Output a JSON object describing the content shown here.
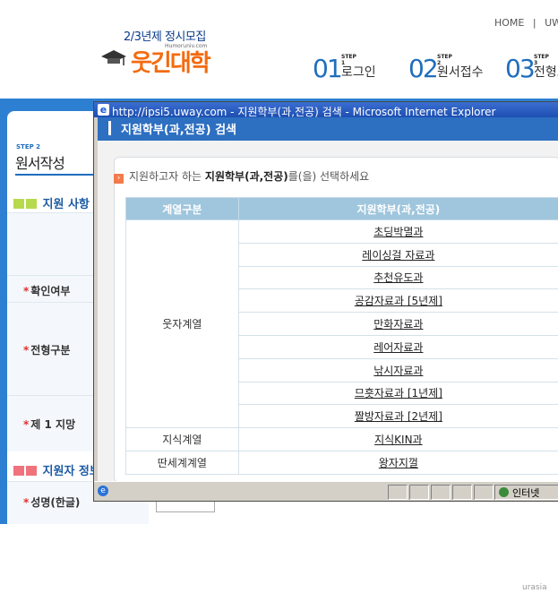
{
  "header": {
    "logo_sub": "2/3년제 정시모집",
    "logo_main": "웃긴대학",
    "logo_url": "Humoruniv.com",
    "top_links": [
      "HOME",
      "|",
      "UWA"
    ],
    "steps": [
      {
        "num": "01",
        "tag": "STEP 1",
        "label": "로그인"
      },
      {
        "num": "02",
        "tag": "STEP 2",
        "label": "원서접수"
      },
      {
        "num": "03",
        "tag": "STEP 3",
        "label": "전형료"
      }
    ]
  },
  "page": {
    "step_tag": "STEP 2",
    "title": "원서작성",
    "section1": "지원 사항",
    "section2": "지원자 정보",
    "rows": [
      {
        "label": "확인여부"
      },
      {
        "label": "전형구분"
      },
      {
        "label": "제 1 지망"
      },
      {
        "label": "성명(한글)"
      }
    ],
    "watermark": "urasia"
  },
  "popup": {
    "window_title": "http://ipsi5.uway.com - 지원학부(과,전공) 검색 - Microsoft Internet Explorer",
    "header": "지원학부(과,전공) 검색",
    "instruction_pre": "지원하고자 하는 ",
    "instruction_bold": "지원학부(과,전공)",
    "instruction_post": "를(을) 선택하세요",
    "table": {
      "headers": [
        "계열구분",
        "지원학부(과,전공)"
      ],
      "groups": [
        {
          "category": "웃자계열",
          "majors": [
            "초딩박멸과",
            "레이싱걸 자료과",
            "추천유도과",
            "공감자료과 [5년제]",
            "만화자료과",
            "레어자료과",
            "낚시자료과",
            "므흣자료과 [1년제]",
            "짤방자료과 [2년제]"
          ]
        },
        {
          "category": "지식계열",
          "majors": [
            "지식KIN과"
          ]
        },
        {
          "category": "딴세계계열",
          "majors": [
            "왕자지껄"
          ]
        }
      ]
    },
    "status_zone": "인터넷"
  }
}
